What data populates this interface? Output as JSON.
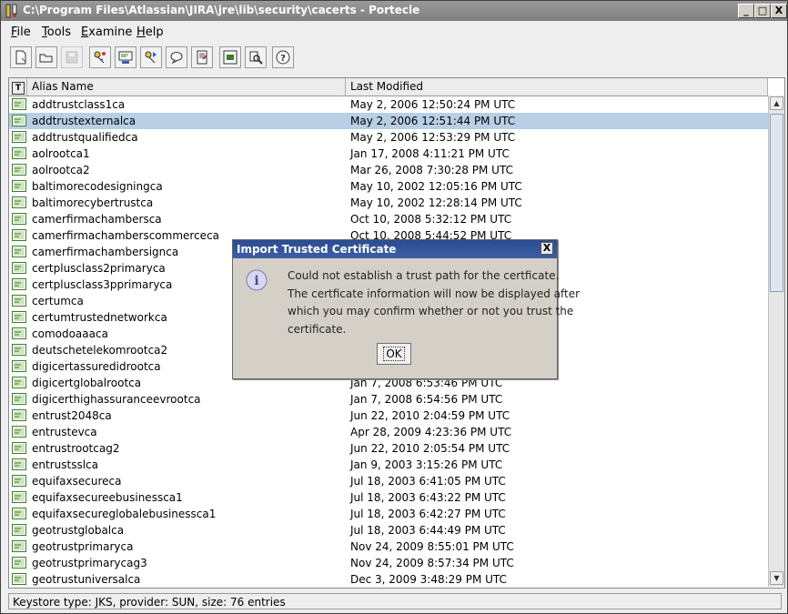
{
  "window": {
    "title": "C:\\Program Files\\Atlassian\\JIRA\\jre\\lib\\security\\cacerts - Portecle",
    "min_label": "_",
    "max_label": "□",
    "close_label": "X"
  },
  "menu": [
    {
      "mnemonic": "F",
      "rest": "ile"
    },
    {
      "mnemonic": "T",
      "rest": "ools"
    },
    {
      "mnemonic": "E",
      "rest": "xamine"
    },
    {
      "mnemonic": "H",
      "rest": "elp"
    }
  ],
  "toolbar": {
    "icons": [
      "new-keystore-icon",
      "open-keystore-icon",
      "save-keystore-icon",
      "generate-keypair-icon",
      "import-trusted-cert-icon",
      "import-keypair-icon",
      "keystore-report-icon",
      "examine-certificate-icon",
      "examine-crl-icon",
      "set-password-icon",
      "help-icon"
    ]
  },
  "table": {
    "columns": {
      "type_icon": "T",
      "alias": "Alias Name",
      "modified": "Last Modified"
    },
    "rows": [
      {
        "alias": "addtrustclass1ca",
        "modified": "May 2, 2006 12:50:24 PM UTC"
      },
      {
        "alias": "addtrustexternalca",
        "modified": "May 2, 2006 12:51:44 PM UTC"
      },
      {
        "alias": "addtrustqualifiedca",
        "modified": "May 2, 2006 12:53:29 PM UTC"
      },
      {
        "alias": "aolrootca1",
        "modified": "Jan 17, 2008 4:11:21 PM UTC"
      },
      {
        "alias": "aolrootca2",
        "modified": "Mar 26, 2008 7:30:28 PM UTC"
      },
      {
        "alias": "baltimorecodesigningca",
        "modified": "May 10, 2002 12:05:16 PM UTC"
      },
      {
        "alias": "baltimorecybertrustca",
        "modified": "May 10, 2002 12:28:14 PM UTC"
      },
      {
        "alias": "camerfirmachambersca",
        "modified": "Oct 10, 2008 5:32:12 PM UTC"
      },
      {
        "alias": "camerfirmachamberscommerceca",
        "modified": "Oct 10, 2008 5:44:52 PM UTC"
      },
      {
        "alias": "camerfirmachambersignca",
        "modified": ""
      },
      {
        "alias": "certplusclass2primaryca",
        "modified": ""
      },
      {
        "alias": "certplusclass3pprimaryca",
        "modified": ""
      },
      {
        "alias": "certumca",
        "modified": ""
      },
      {
        "alias": "certumtrustednetworkca",
        "modified": ""
      },
      {
        "alias": "comodoaaaca",
        "modified": ""
      },
      {
        "alias": "deutschetelekomrootca2",
        "modified": ""
      },
      {
        "alias": "digicertassuredidrootca",
        "modified": ""
      },
      {
        "alias": "digicertglobalrootca",
        "modified": "Jan 7, 2008 6:53:46 PM UTC"
      },
      {
        "alias": "digicerthighassuranceevrootca",
        "modified": "Jan 7, 2008 6:54:56 PM UTC"
      },
      {
        "alias": "entrust2048ca",
        "modified": "Jun 22, 2010 2:04:59 PM UTC"
      },
      {
        "alias": "entrustevca",
        "modified": "Apr 28, 2009 4:23:36 PM UTC"
      },
      {
        "alias": "entrustrootcag2",
        "modified": "Jun 22, 2010 2:05:54 PM UTC"
      },
      {
        "alias": "entrustsslca",
        "modified": "Jan 9, 2003 3:15:26 PM UTC"
      },
      {
        "alias": "equifaxsecureca",
        "modified": "Jul 18, 2003 6:41:05 PM UTC"
      },
      {
        "alias": "equifaxsecureebusinessca1",
        "modified": "Jul 18, 2003 6:43:22 PM UTC"
      },
      {
        "alias": "equifaxsecureglobalebusinessca1",
        "modified": "Jul 18, 2003 6:42:27 PM UTC"
      },
      {
        "alias": "geotrustglobalca",
        "modified": "Jul 18, 2003 6:44:49 PM UTC"
      },
      {
        "alias": "geotrustprimaryca",
        "modified": "Nov 24, 2009 8:55:01 PM UTC"
      },
      {
        "alias": "geotrustprimarycag3",
        "modified": "Nov 24, 2009 8:57:34 PM UTC"
      },
      {
        "alias": "geotrustuniversalca",
        "modified": "Dec 3, 2009 3:48:29 PM UTC"
      }
    ],
    "selected_alias": "addtrustexternalca"
  },
  "status": {
    "text": "Keystore type: JKS, provider: SUN, size: 76 entries"
  },
  "dialog": {
    "title": "Import Trusted Certificate",
    "close_label": "X",
    "message_lines": [
      "Could not establish a trust path for the certficate.",
      "The certficate information will now be displayed after",
      "which you may confirm whether or not you trust the",
      "certificate."
    ],
    "ok_label": "OK"
  },
  "colors": {
    "selection": "#b8cfe5",
    "titlebar": "#8a8a8a",
    "dialog_title": "#2f4f93",
    "cert_icon": "#3d7a2e"
  }
}
